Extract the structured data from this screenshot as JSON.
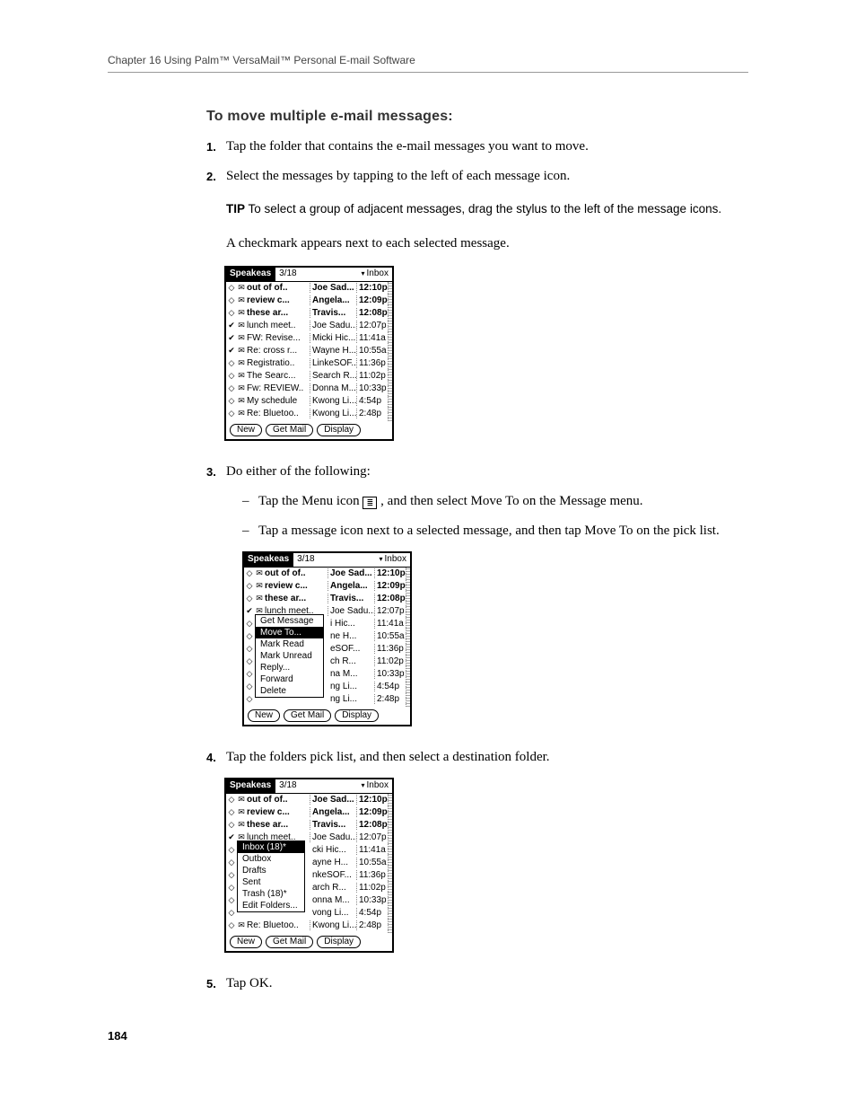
{
  "header": "Chapter 16   Using Palm™ VersaMail™ Personal E-mail Software",
  "page_number": "184",
  "section_title": "To move multiple e-mail messages:",
  "steps": {
    "s1": {
      "num": "1.",
      "text": "Tap the folder that contains the e-mail messages you want to move."
    },
    "s2": {
      "num": "2.",
      "text": "Select the messages by tapping to the left of each message icon."
    },
    "s3": {
      "num": "3.",
      "text": "Do either of the following:"
    },
    "s4": {
      "num": "4.",
      "text": "Tap the folders pick list, and then select a destination folder."
    },
    "s5": {
      "num": "5.",
      "text": "Tap OK."
    }
  },
  "tip": {
    "label": "TIP",
    "text": "To select a group of adjacent messages, drag the stylus to the left of the message icons."
  },
  "para_checkmark": "A checkmark appears next to each selected message.",
  "sub3a_pre": "Tap the Menu icon ",
  "sub3a_post": " , and then select Move To on the Message menu.",
  "sub3b": "Tap a message icon next to a selected message, and then tap Move To on the pick list.",
  "ss_common": {
    "app": "Speakeas",
    "count": "3/18",
    "folder": "Inbox",
    "btn_new": "New",
    "btn_get": "Get Mail",
    "btn_display": "Display",
    "rows": [
      {
        "mark": "◇",
        "env": "✉",
        "subj": "out of of..",
        "from": "Joe Sad...",
        "time": "12:10p",
        "bold": true
      },
      {
        "mark": "◇",
        "env": "✉",
        "subj": "review c...",
        "from": "Angela...",
        "time": "12:09p",
        "bold": true
      },
      {
        "mark": "◇",
        "env": "✉",
        "subj": "these ar...",
        "from": "Travis...",
        "time": "12:08p",
        "bold": true
      },
      {
        "mark": "✔",
        "env": "✉",
        "subj": "lunch meet..",
        "from": "Joe Sadu...",
        "time": "12:07p",
        "bold": false
      },
      {
        "mark": "✔",
        "env": "✉",
        "subj": "FW: Revise...",
        "from": "Micki Hic...",
        "time": "11:41a",
        "bold": false
      },
      {
        "mark": "✔",
        "env": "✉",
        "subj": "Re: cross r...",
        "from": "Wayne H...",
        "time": "10:55a",
        "bold": false
      },
      {
        "mark": "◇",
        "env": "✉",
        "subj": "Registratio..",
        "from": "LinkeSOF...",
        "time": "11:36p",
        "bold": false
      },
      {
        "mark": "◇",
        "env": "✉",
        "subj": "The Searc...",
        "from": "Search R...",
        "time": "11:02p",
        "bold": false
      },
      {
        "mark": "◇",
        "env": "✉",
        "subj": "Fw: REVIEW..",
        "from": "Donna M...",
        "time": "10:33p",
        "bold": false
      },
      {
        "mark": "◇",
        "env": "✉",
        "subj": "My schedule",
        "from": "Kwong Li...",
        "time": "4:54p",
        "bold": false
      },
      {
        "mark": "◇",
        "env": "✉",
        "subj": "Re: Bluetoo..",
        "from": "Kwong Li...",
        "time": "2:48p",
        "bold": false
      }
    ]
  },
  "ss2": {
    "rows_short": [
      {
        "mark": "◇",
        "env": "✉",
        "subj": "out of of..",
        "from": "Joe Sad...",
        "time": "12:10p",
        "bold": true
      },
      {
        "mark": "◇",
        "env": "✉",
        "subj": "review c...",
        "from": "Angela...",
        "time": "12:09p",
        "bold": true
      },
      {
        "mark": "◇",
        "env": "✉",
        "subj": "these ar...",
        "from": "Travis...",
        "time": "12:08p",
        "bold": true
      },
      {
        "mark": "✔",
        "env": "✉",
        "subj": "lunch meet..",
        "from": "Joe Sadu...",
        "time": "12:07p",
        "bold": false
      }
    ],
    "peek_rows": [
      {
        "from": "i Hic...",
        "time": "11:41a"
      },
      {
        "from": "ne H...",
        "time": "10:55a"
      },
      {
        "from": "eSOF...",
        "time": "11:36p"
      },
      {
        "from": "ch R...",
        "time": "11:02p"
      },
      {
        "from": "na M...",
        "time": "10:33p"
      },
      {
        "from": "ng Li...",
        "time": "4:54p"
      },
      {
        "from": "ng Li...",
        "time": "2:48p"
      }
    ],
    "popup": [
      "Get Message",
      "Move To...",
      "Mark Read",
      "Mark Unread",
      "Reply...",
      "Forward",
      "Delete"
    ],
    "popup_sel": 1
  },
  "ss3": {
    "rows_short": [
      {
        "mark": "◇",
        "env": "✉",
        "subj": "out of of..",
        "from": "Joe Sad...",
        "time": "12:10p",
        "bold": true
      },
      {
        "mark": "◇",
        "env": "✉",
        "subj": "review c...",
        "from": "Angela...",
        "time": "12:09p",
        "bold": true
      },
      {
        "mark": "◇",
        "env": "✉",
        "subj": "these ar...",
        "from": "Travis...",
        "time": "12:08p",
        "bold": true
      },
      {
        "mark": "✔",
        "env": "✉",
        "subj": "lunch meet..",
        "from": "Joe Sadu...",
        "time": "12:07p",
        "bold": false
      }
    ],
    "peek_rows": [
      {
        "from": "cki Hic...",
        "time": "11:41a"
      },
      {
        "from": "ayne H...",
        "time": "10:55a"
      },
      {
        "from": "nkeSOF...",
        "time": "11:36p"
      },
      {
        "from": "arch R...",
        "time": "11:02p"
      },
      {
        "from": "onna M...",
        "time": "10:33p"
      },
      {
        "from": "vong Li...",
        "time": "4:54p"
      }
    ],
    "last_row": {
      "mark": "◇",
      "env": "✉",
      "subj": "Re: Bluetoo..",
      "from": "Kwong Li...",
      "time": "2:48p"
    },
    "popup": [
      "Inbox (18)*",
      "Outbox",
      "Drafts",
      "Sent",
      "Trash (18)*",
      "Edit Folders..."
    ],
    "popup_sel": 0
  }
}
